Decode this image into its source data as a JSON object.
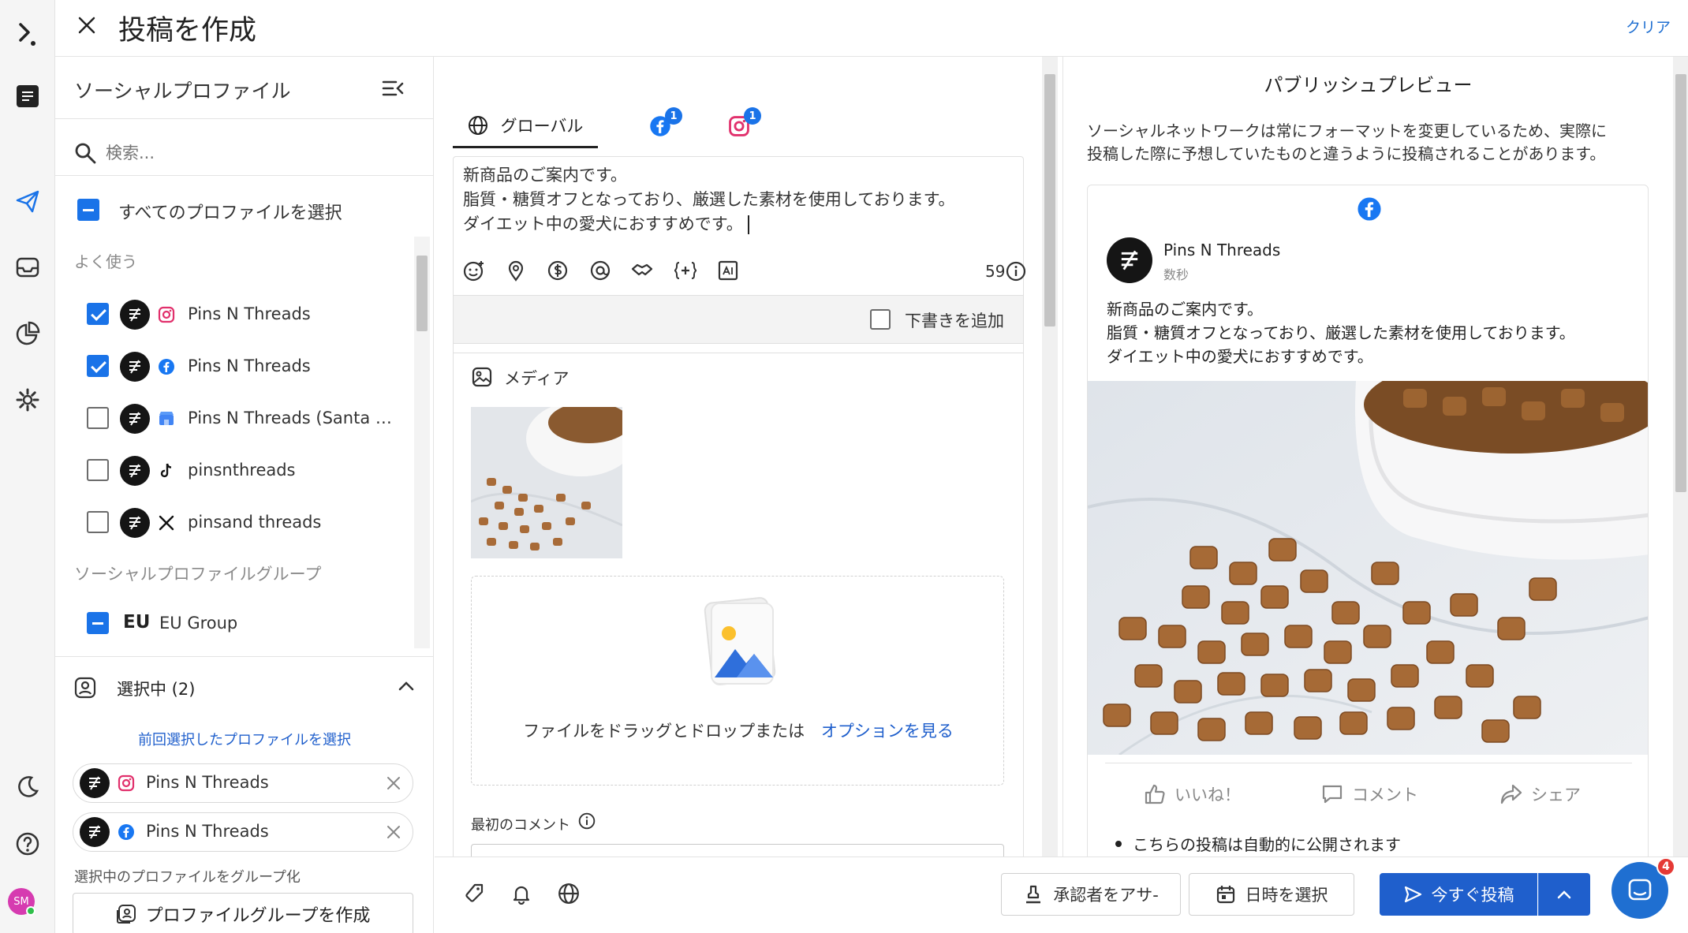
{
  "header": {
    "title": "投稿を作成",
    "clear_label": "クリア"
  },
  "profiles_panel": {
    "title": "ソーシャルプロファイル",
    "search_placeholder": "検索...",
    "select_all_label": "すべてのプロファイルを選択",
    "frequent_label": "よく使う",
    "profiles": [
      {
        "name": "Pins N Threads",
        "network": "instagram",
        "checked": true
      },
      {
        "name": "Pins N Threads",
        "network": "facebook",
        "checked": true
      },
      {
        "name": "Pins N Threads (Santa M...",
        "network": "google-business",
        "checked": false
      },
      {
        "name": "pinsnthreads",
        "network": "tiktok",
        "checked": false
      },
      {
        "name": "pinsand threads",
        "network": "x",
        "checked": false
      }
    ],
    "groups_label": "ソーシャルプロファイルグループ",
    "groups": [
      {
        "abbr": "EU",
        "name": "EU Group"
      }
    ],
    "selected_label": "選択中 (2)",
    "previous_link": "前回選択したプロファイルを選択",
    "selected_chips": [
      {
        "name": "Pins N Threads",
        "network": "instagram"
      },
      {
        "name": "Pins N Threads",
        "network": "facebook"
      }
    ],
    "group_hint": "選択中のプロファイルをグループ化",
    "create_group_label": "プロファイルグループを作成"
  },
  "editor": {
    "tabs": [
      {
        "label": "グローバル"
      },
      {
        "label": "",
        "badge": "1",
        "network": "facebook"
      },
      {
        "label": "",
        "badge": "1",
        "network": "instagram"
      }
    ],
    "text_lines": [
      "新商品のご案内です。",
      "脂質・糖質オフとなっており、厳選した素材を使用しております。",
      "ダイエット中の愛犬におすすめです。"
    ],
    "char_count": "59",
    "draft_label": "下書きを追加",
    "media_label": "メディア",
    "drop_text": "ファイルをドラッグとドロップまたは",
    "options_link": "オプションを見る",
    "first_comment_label": "最初のコメント"
  },
  "footer": {
    "approver_label": "承認者をアサ-",
    "schedule_label": "日時を選択",
    "post_now_label": "今すぐ投稿"
  },
  "preview": {
    "title": "パブリッシュプレビュー",
    "notice": [
      "ソーシャルネットワークは常にフォーマットを変更しているため、実際に",
      "投稿した際に予想していたものと違うように投稿されることがあります。"
    ],
    "account_name": "Pins N Threads",
    "timestamp": "数秒",
    "post_lines": [
      "新商品のご案内です。",
      "脂質・糖質オフとなっており、厳選した素材を使用しております。",
      "ダイエット中の愛犬におすすめです。"
    ],
    "like_label": "いいね！",
    "comment_label": "コメント",
    "share_label": "シェア",
    "auto_publish_note": "こちらの投稿は自動的に公開されます"
  },
  "user": {
    "initials": "SM"
  },
  "chat": {
    "badge": "4"
  },
  "colors": {
    "accent": "#1a73e8",
    "primary_button": "#1f5fcc",
    "facebook": "#1877f2",
    "instagram": "#e1306c"
  }
}
